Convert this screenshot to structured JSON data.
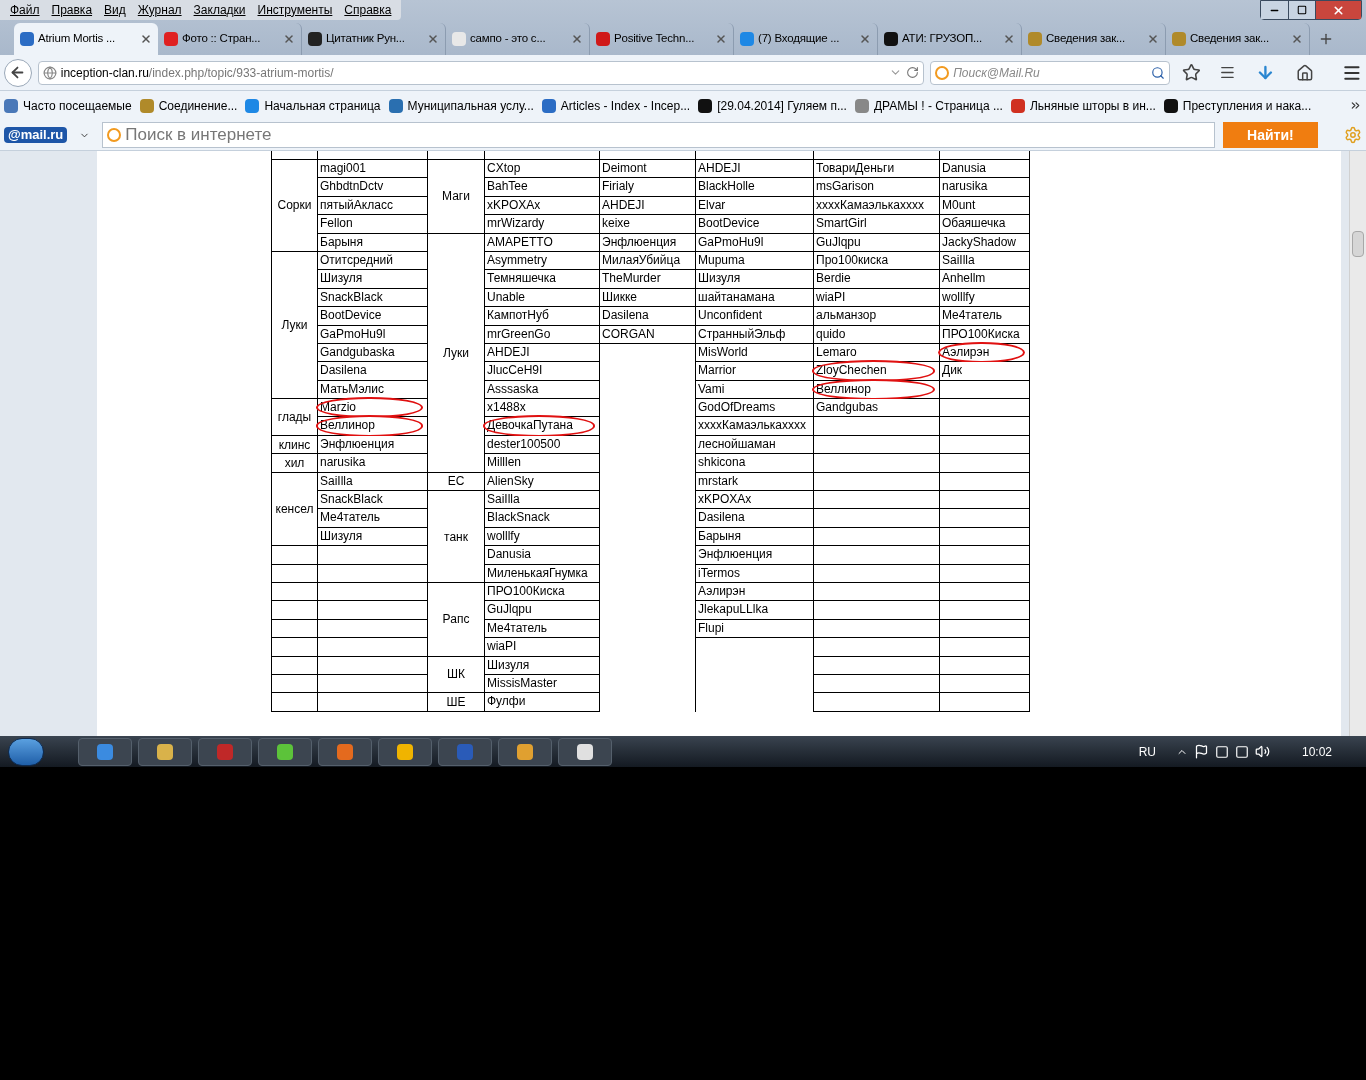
{
  "menu": [
    "Файл",
    "Правка",
    "Вид",
    "Журнал",
    "Закладки",
    "Инструменты",
    "Справка"
  ],
  "tabs": [
    {
      "title": "Atrium Mortis ...",
      "selected": true
    },
    {
      "title": "Фото :: Стран...",
      "selected": false
    },
    {
      "title": "Цитатник Рун...",
      "selected": false
    },
    {
      "title": "сампо - это с...",
      "selected": false
    },
    {
      "title": "Positive Techn...",
      "selected": false
    },
    {
      "title": "(7) Входящие ...",
      "selected": false
    },
    {
      "title": "АТИ: ГРУЗОП...",
      "selected": false
    },
    {
      "title": "Сведения зак...",
      "selected": false
    },
    {
      "title": "Сведения зак...",
      "selected": false
    }
  ],
  "address": {
    "host": "inception-clan.ru",
    "path": "/index.php/topic/933-atrium-mortis/"
  },
  "search": {
    "placeholder": "Поиск@Mail.Ru"
  },
  "bookmarks": [
    "Часто посещаемые",
    "Соединение...",
    "Начальная страница",
    "Муниципальная услу...",
    "Articles - Index - Incep...",
    "[29.04.2014] Гуляем п...",
    "ДРАМЫ ! - Страница ...",
    "Льняные шторы в ин...",
    "Преступления и нака..."
  ],
  "mail_bar": {
    "logo": "@mail.ru",
    "placeholder": "Поиск в интернете",
    "button": "Найти!"
  },
  "sheet": {
    "section_1": [
      {
        "label": "Сорки",
        "names": [
          {
            "text": "magi001",
            "circled": false
          },
          {
            "text": "GhbdtnDctv",
            "circled": false
          },
          {
            "text": "пятыйАкласс",
            "circled": false
          },
          {
            "text": "Fellon",
            "circled": false
          },
          {
            "text": "Барыня",
            "circled": false
          }
        ]
      },
      {
        "label": "Луки",
        "names": [
          {
            "text": "Отитсредний",
            "circled": false
          },
          {
            "text": "Шизуля",
            "circled": false
          },
          {
            "text": "SnackBlack",
            "circled": false
          },
          {
            "text": "BootDevice",
            "circled": false
          },
          {
            "text": "GaPmoHu9l",
            "circled": false
          },
          {
            "text": "Gandgubaska",
            "circled": false
          },
          {
            "text": "Dasilena",
            "circled": false
          },
          {
            "text": "МатьМэлис",
            "circled": false
          }
        ]
      },
      {
        "label": "глады",
        "names": [
          {
            "text": "Marzio",
            "circled": true
          },
          {
            "text": "Веллинор",
            "circled": true
          }
        ]
      },
      {
        "label": "клинс",
        "names": [
          {
            "text": "Энфлюенция",
            "circled": false
          }
        ]
      },
      {
        "label": "хил",
        "names": [
          {
            "text": "narusika",
            "circled": false
          }
        ]
      },
      {
        "label": "кенсел",
        "names": [
          {
            "text": "SaiIlla",
            "circled": false
          },
          {
            "text": "SnackBlack",
            "circled": false
          },
          {
            "text": "Me4татель",
            "circled": false
          },
          {
            "text": "Шизуля",
            "circled": false
          }
        ]
      }
    ],
    "section_2": [
      {
        "label": "Маги",
        "names": [
          {
            "text": "CXtop",
            "circled": false
          },
          {
            "text": "BahTee",
            "circled": false
          },
          {
            "text": "xKPOXAx",
            "circled": false
          },
          {
            "text": "mrWizardy",
            "circled": false
          }
        ]
      },
      {
        "label": "Луки",
        "names": [
          {
            "text": "AMAPETTO",
            "circled": false
          },
          {
            "text": "Asymmetry",
            "circled": false
          },
          {
            "text": "Темняшечка",
            "circled": false
          },
          {
            "text": "Unable",
            "circled": false
          },
          {
            "text": "КампотНуб",
            "circled": false
          },
          {
            "text": "mrGreenGo",
            "circled": false
          },
          {
            "text": "AHDEJI",
            "circled": false
          },
          {
            "text": "JlucCeH9I",
            "circled": false
          },
          {
            "text": "Asssaska",
            "circled": false
          },
          {
            "text": "x1488x",
            "circled": false
          },
          {
            "text": "ДевочкаПутана",
            "circled": true
          },
          {
            "text": "dester100500",
            "circled": false
          },
          {
            "text": "Milllen",
            "circled": false
          }
        ]
      },
      {
        "label": "ЕС",
        "names": [
          {
            "text": "AlienSky",
            "circled": false
          }
        ]
      },
      {
        "label": "танк",
        "names": [
          {
            "text": "SaiIlla",
            "circled": false
          },
          {
            "text": "BlackSnack",
            "circled": false
          },
          {
            "text": "wolllfy",
            "circled": false
          },
          {
            "text": "Danusia",
            "circled": false
          },
          {
            "text": "МиленькаяГнумка",
            "circled": false
          }
        ]
      },
      {
        "label": "Рапс",
        "names": [
          {
            "text": "ПРО100Киска",
            "circled": false
          },
          {
            "text": "GuJlqpu",
            "circled": false
          },
          {
            "text": "Me4татель",
            "circled": false
          },
          {
            "text": "wiaPI",
            "circled": false
          }
        ]
      },
      {
        "label": "ШК",
        "names": [
          {
            "text": "Шизуля",
            "circled": false
          },
          {
            "text": "MissisMaster",
            "circled": false
          }
        ]
      },
      {
        "label": "ШЕ",
        "names": [
          {
            "text": "Фулфи",
            "circled": false
          }
        ]
      }
    ],
    "column_5": [
      {
        "text": "Deimont",
        "circled": false
      },
      {
        "text": "Firialy",
        "circled": false
      },
      {
        "text": "AHDEJI",
        "circled": false
      },
      {
        "text": "keixe",
        "circled": false
      },
      {
        "text": "Энфлюенция",
        "circled": false
      },
      {
        "text": "МилаяУбийца",
        "circled": false
      },
      {
        "text": "TheMurder",
        "circled": false
      },
      {
        "text": "Шикке",
        "circled": false
      },
      {
        "text": "Dasilena",
        "circled": false
      },
      {
        "text": "CORGAN",
        "circled": false
      }
    ],
    "column_6": [
      {
        "text": "AHDEJI",
        "circled": false
      },
      {
        "text": "BlackHolle",
        "circled": false
      },
      {
        "text": "Elvar",
        "circled": false
      },
      {
        "text": "BootDevice",
        "circled": false
      },
      {
        "text": "GaPmoHu9l",
        "circled": false
      },
      {
        "text": "Mupuma",
        "circled": false
      },
      {
        "text": "Шизуля",
        "circled": false
      },
      {
        "text": "шайтанамана",
        "circled": false
      },
      {
        "text": "Unconfident",
        "circled": false
      },
      {
        "text": "СтранныйЭльф",
        "circled": false
      },
      {
        "text": "MisWorld",
        "circled": false
      },
      {
        "text": "Marrior",
        "circled": false
      },
      {
        "text": "Vami",
        "circled": false
      },
      {
        "text": "GodOfDreams",
        "circled": false
      },
      {
        "text": "xxxxКамаэлькаxxxx",
        "circled": false
      },
      {
        "text": "леснойшаман",
        "circled": false
      },
      {
        "text": "shkicona",
        "circled": false
      },
      {
        "text": "mrstark",
        "circled": false
      },
      {
        "text": "xKPOXAx",
        "circled": false
      },
      {
        "text": "Dasilena",
        "circled": false
      },
      {
        "text": "Барыня",
        "circled": false
      },
      {
        "text": "Энфлюенция",
        "circled": false
      },
      {
        "text": "iTermos",
        "circled": false
      },
      {
        "text": "Аэлирэн",
        "circled": false
      },
      {
        "text": "JlekapuLLlka",
        "circled": false
      },
      {
        "text": "Flupi",
        "circled": false
      }
    ],
    "column_7": [
      {
        "text": "ТовариДеньги",
        "circled": false
      },
      {
        "text": "msGarison",
        "circled": false
      },
      {
        "text": "xxxxКамаэлькаxxxx",
        "circled": false
      },
      {
        "text": "SmartGirl",
        "circled": false
      },
      {
        "text": "GuJlqpu",
        "circled": false
      },
      {
        "text": "Про100киска",
        "circled": false
      },
      {
        "text": "Berdie",
        "circled": false
      },
      {
        "text": "wiaPI",
        "circled": false
      },
      {
        "text": "альманзор",
        "circled": false
      },
      {
        "text": "quido",
        "circled": false
      },
      {
        "text": "Lemaro",
        "circled": false
      },
      {
        "text": "ZloyChechen",
        "circled": true
      },
      {
        "text": "Веллинор",
        "circled": true
      },
      {
        "text": "Gandgubas",
        "circled": false
      }
    ],
    "column_8": [
      {
        "text": "Danusia",
        "circled": false
      },
      {
        "text": "narusika",
        "circled": false
      },
      {
        "text": "M0unt",
        "circled": false
      },
      {
        "text": "Обаяшечка",
        "circled": false
      },
      {
        "text": "JackyShadow",
        "circled": false
      },
      {
        "text": "SaiIlla",
        "circled": false
      },
      {
        "text": "Anhellm",
        "circled": false
      },
      {
        "text": "wolllfy",
        "circled": false
      },
      {
        "text": "Me4татель",
        "circled": false
      },
      {
        "text": "ПРО100Киска",
        "circled": false
      },
      {
        "text": "Аэлирэн",
        "circled": true
      },
      {
        "text": "Дик",
        "circled": false
      }
    ]
  },
  "taskbar": {
    "language": "RU",
    "clock": "10:02"
  }
}
